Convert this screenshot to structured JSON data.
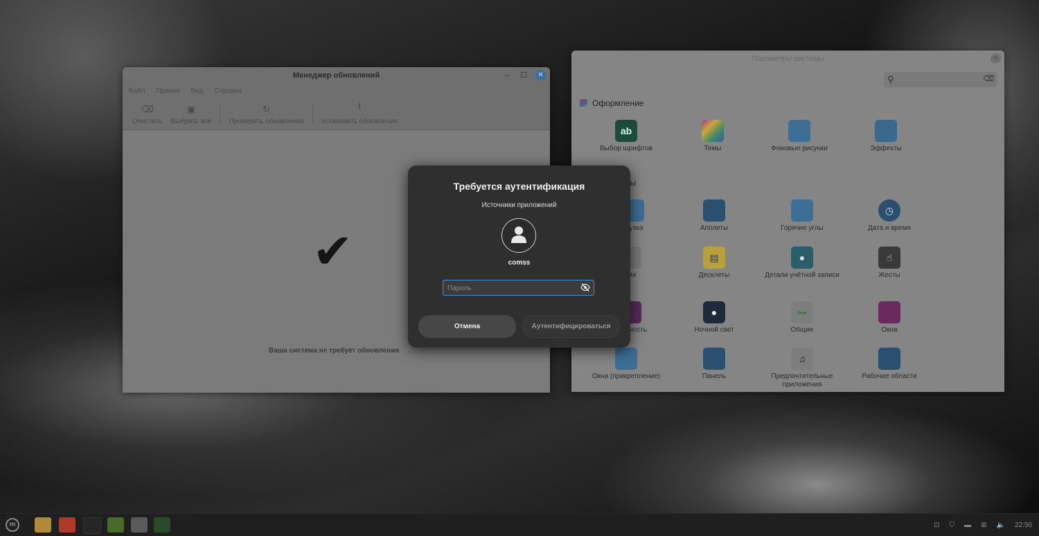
{
  "update_manager": {
    "title": "Менеджер обновлений",
    "menu": [
      "Файл",
      "Правка",
      "Вид",
      "Справка"
    ],
    "toolbar": [
      {
        "label": "Очистить",
        "icon": "eraser-icon"
      },
      {
        "label": "Выбрать все",
        "icon": "select-all-icon"
      },
      {
        "label": "Проверить обновления",
        "icon": "refresh-icon"
      },
      {
        "label": "Установить обновления",
        "icon": "download-icon"
      }
    ],
    "status": "Ваша система не требует обновления",
    "checkmark": "✔"
  },
  "system_settings": {
    "title": "Параметры системы",
    "search_placeholder": "",
    "sections": [
      {
        "title": "Оформление",
        "items": [
          "Выбор шрифтов",
          "Темы",
          "Фоновые рисунки",
          "Эффекты"
        ]
      },
      {
        "title": "ры",
        "items": [
          "грузка",
          "Апплеты",
          "Горячие углы",
          "Дата и время",
          "вия",
          "Десклеты",
          "Детали учётной записи",
          "Жесты",
          "нальность",
          "Ночной свет",
          "Общие",
          "Окна",
          "Окна (прикрепление)",
          "Панель",
          "Предпочтительные приложения",
          "Рабочие области"
        ]
      }
    ]
  },
  "auth_dialog": {
    "title": "Требуется аутентификация",
    "subtitle": "Источники приложений",
    "username": "comss",
    "password_placeholder": "Пароль",
    "password_value": "",
    "cancel_label": "Отмена",
    "auth_label": "Аутентифицироваться"
  },
  "taskbar": {
    "clock": "22:50"
  },
  "colors": {
    "accent": "#4a8ad0",
    "dialog_bg": "#2f2f2f"
  }
}
